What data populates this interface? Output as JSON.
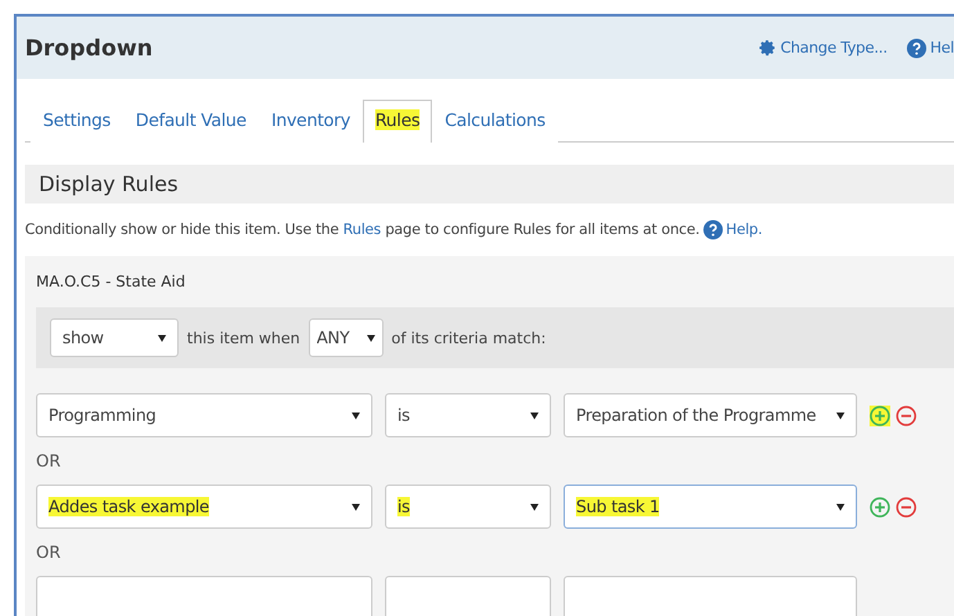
{
  "header": {
    "title": "Dropdown",
    "actions": [
      {
        "kind": "gear",
        "label": "Change Type..."
      },
      {
        "kind": "help",
        "label": "Hel"
      }
    ]
  },
  "tabs": [
    {
      "label": "Settings",
      "selected": false,
      "highlighted": false
    },
    {
      "label": "Default Value",
      "selected": false,
      "highlighted": false
    },
    {
      "label": "Inventory",
      "selected": false,
      "highlighted": false
    },
    {
      "label": "Rules",
      "selected": true,
      "highlighted": true
    },
    {
      "label": "Calculations",
      "selected": false,
      "highlighted": false
    }
  ],
  "section": {
    "title": "Display Rules",
    "description_before": "Conditionally show or hide this item. Use the",
    "description_link": "Rules",
    "description_after": "page to configure Rules for all items at once.",
    "help_link": "Help."
  },
  "rule_group": {
    "name": "MA.O.C5 - State Aid",
    "action": "show",
    "middle_text": "this item when",
    "match": "ANY",
    "end_text": "of its criteria match:",
    "criteria": [
      {
        "field": {
          "value": "Programming",
          "highlighted": false
        },
        "operator": {
          "value": "is",
          "highlighted": false
        },
        "target": {
          "value": "Preparation of the Programme",
          "highlighted": false,
          "focused": false
        },
        "add_highlighted": true
      },
      {
        "field": {
          "value": "Addes task example",
          "highlighted": true
        },
        "operator": {
          "value": "is",
          "highlighted": true
        },
        "target": {
          "value": "Sub task 1",
          "highlighted": true,
          "focused": true
        },
        "add_highlighted": false
      },
      {
        "kind": "partial"
      }
    ],
    "separators": [
      "OR",
      "OR"
    ]
  }
}
